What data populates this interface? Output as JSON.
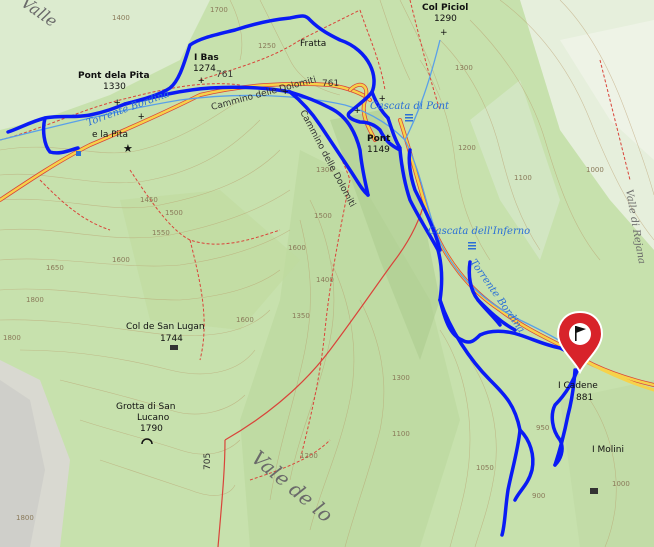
{
  "places": {
    "col_piciol": {
      "name": "Col Piciol",
      "ele": "1290"
    },
    "pont_dela_pita": {
      "name": "Pont dela Pita",
      "ele": "1330"
    },
    "i_bas": {
      "name": "I Bas",
      "ele": "1274"
    },
    "pont": {
      "name": "Pont",
      "ele": "1149"
    },
    "col_de_san_lugan": {
      "name": "Col de San Lugan",
      "ele": "1744"
    },
    "grotta": {
      "name1": "Grotta di San",
      "name2": "Lucano",
      "ele": "1790"
    },
    "i_cadene": {
      "name": "I Cadene",
      "ele": "881"
    },
    "i_molini": {
      "name": "I Molini"
    },
    "fratta": {
      "name": "Fratta"
    },
    "pita_area": {
      "name": "e la Pita"
    }
  },
  "water": {
    "torrente_bordina_w": "Torrente Bordina",
    "torrente_bordina_e": "Torrente Bordina",
    "cascata_pont": "Cascata di Pont",
    "cascata_inferno": "Cascata dell'Inferno"
  },
  "paths": {
    "cammino_1": "Cammino delle Dolomiti",
    "cammino_2": "Cammino delle Dolomiti",
    "road_761a": "761",
    "road_761b": "761",
    "road_705": "705"
  },
  "valleys": {
    "vale_de_lo": "Vale de lo",
    "valle_rejana": "Valle di Rejana",
    "top_left": "Valle"
  },
  "contours": [
    "1300",
    "1400",
    "1500",
    "1600",
    "1700",
    "1800",
    "1550",
    "1650",
    "1450",
    "1250",
    "1350",
    "1200",
    "1100",
    "1000",
    "950",
    "900",
    "1050",
    "1150"
  ],
  "colors": {
    "track": "#0a1bf5",
    "road": "#f6d24a",
    "path_red": "#d9443a",
    "water": "#2a6fd6",
    "pin": "#d8232a"
  }
}
